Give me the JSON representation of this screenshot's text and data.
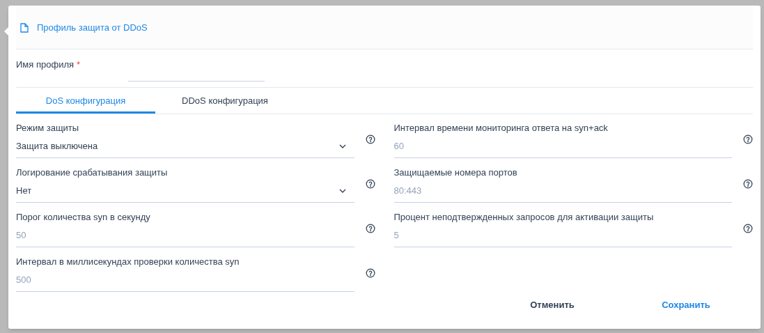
{
  "dialog": {
    "title": "Профиль защита от DDoS"
  },
  "profile_name": {
    "label": "Имя профиля",
    "required_mark": "*"
  },
  "tabs": [
    {
      "label": "DoS конфигурация",
      "selected": true
    },
    {
      "label": "DDoS конфигурация",
      "selected": false
    }
  ],
  "left_fields": [
    {
      "kind": "select",
      "label": "Режим защиты",
      "value": "Защита выключена"
    },
    {
      "kind": "select",
      "label": "Логирование срабатывания защиты",
      "value": "Нет"
    },
    {
      "kind": "input",
      "label": "Порог количества syn в секунду",
      "placeholder": "50"
    },
    {
      "kind": "input",
      "label": "Интервал в миллисекундах проверки количества syn",
      "placeholder": "500"
    }
  ],
  "right_fields": [
    {
      "kind": "input",
      "label": "Интервал времени мониторинга ответа на syn+ack",
      "placeholder": "60"
    },
    {
      "kind": "input",
      "label": "Защищаемые номера портов",
      "placeholder": "80:443"
    },
    {
      "kind": "input",
      "label": "Процент неподтвержденных запросов для активации защиты",
      "placeholder": "5"
    }
  ],
  "buttons": [
    {
      "kind": "secondary",
      "label": "Отменить"
    },
    {
      "kind": "primary",
      "label": "Сохранить"
    }
  ]
}
